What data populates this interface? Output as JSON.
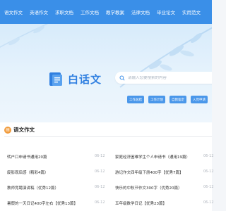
{
  "nav": {
    "items": [
      "语文作文",
      "英语作文",
      "求职文档",
      "工作文档",
      "教学教案",
      "法律文档",
      "毕业论文",
      "实用范文"
    ]
  },
  "hero": {
    "logo_text": "白话文",
    "search_placeholder": "请输入您要搜索的内容",
    "chips": [
      "工作总结",
      "工作计划",
      "自我鉴定",
      "入党申请"
    ]
  },
  "section": {
    "title": "语文作文",
    "items_left": [
      {
        "title": "转户口申请书通用20篇",
        "date": "06-12"
      },
      {
        "title": "废影观后感（精彩4篇）",
        "date": "06-12"
      },
      {
        "title": "教师竞聘演讲稿（优秀12篇）",
        "date": "06-12"
      },
      {
        "title": "暑假的一天日记400字左右【优秀13篇】",
        "date": "06-12"
      }
    ],
    "items_right": [
      {
        "title": "家庭经济困难学生个人申请书（通用19篇）",
        "date": "06-12"
      },
      {
        "title": "游记作文四年级下册400字【优秀7篇】",
        "date": "06-12"
      },
      {
        "title": "快乐的中秋节作文300字（优秀20篇）",
        "date": "06-12"
      },
      {
        "title": "五年级数学日记【优秀23篇】",
        "date": "06-12"
      }
    ]
  },
  "colors": {
    "nav_bg": "#3a8fe8",
    "accent": "#2f7fe0",
    "chip_bg": "#4a97ea",
    "section_icon": "#f19b3b"
  }
}
